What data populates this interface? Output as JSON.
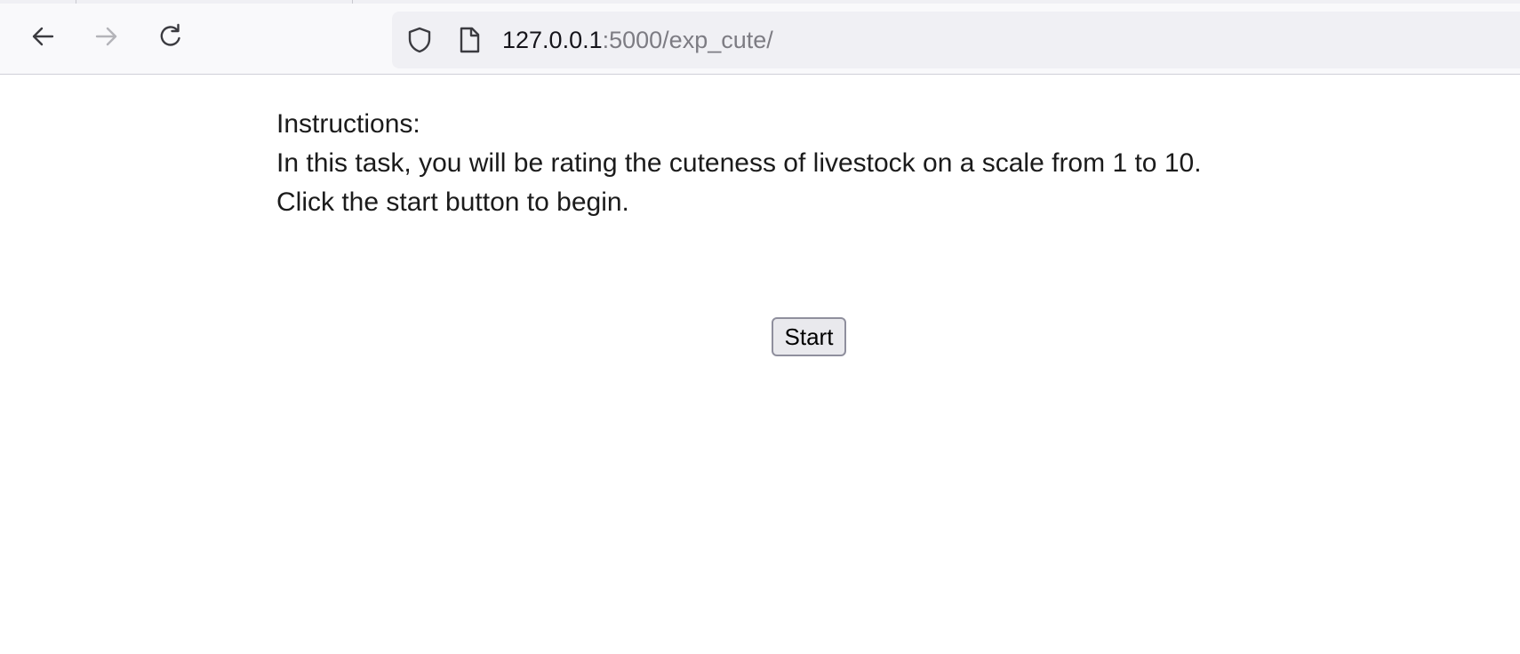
{
  "browser": {
    "url_host": "127.0.0.1",
    "url_rest": ":5000/exp_cute/",
    "icons": {
      "back": "back-arrow-icon",
      "forward": "forward-arrow-icon",
      "reload": "reload-icon",
      "shield": "shield-icon",
      "page": "page-icon"
    },
    "forward_enabled": false
  },
  "instructions": {
    "heading": "Instructions:",
    "line1": "In this task, you will be rating the cuteness of livestock on a scale from 1 to 10.",
    "line2": "Click the start button to begin."
  },
  "start_button": {
    "label": "Start"
  },
  "colors": {
    "toolbar_bg": "#f9f9fb",
    "urlbar_bg": "#f0f0f4",
    "text": "#1b1b1b",
    "button_bg": "#e9e9ed",
    "button_border": "#8f8f9d"
  }
}
